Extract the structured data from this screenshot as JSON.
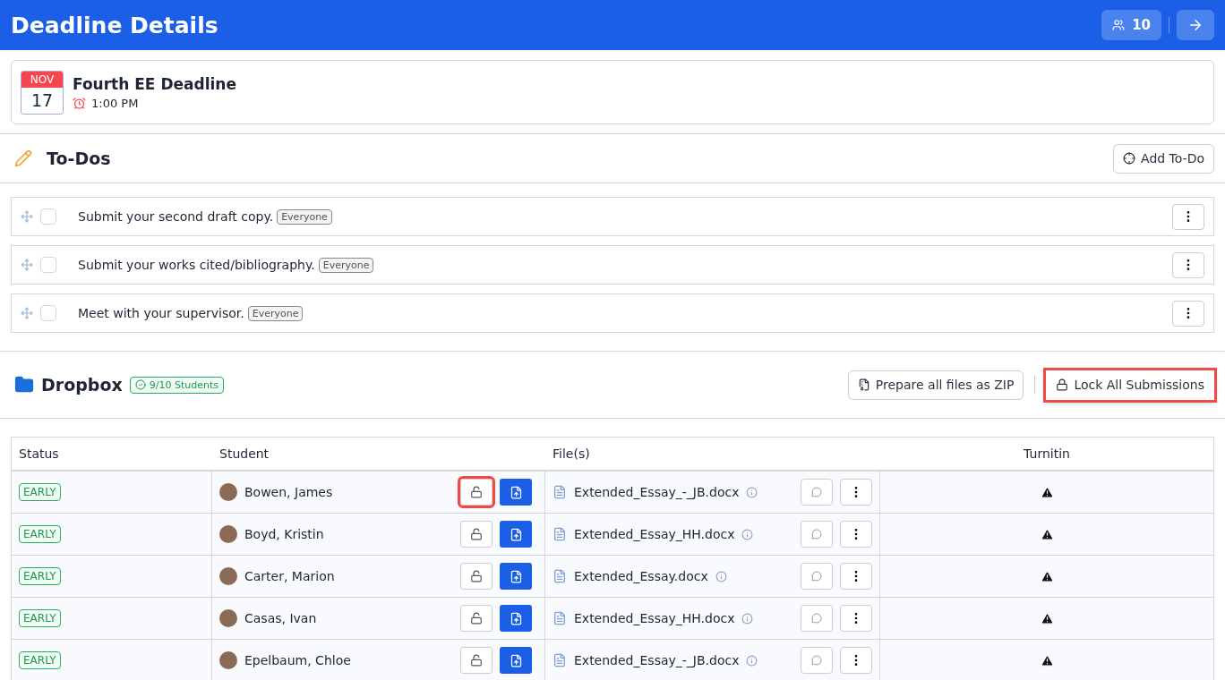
{
  "header": {
    "title": "Deadline Details",
    "members_count": "10"
  },
  "deadline": {
    "month": "NOV",
    "day": "17",
    "title": "Fourth EE Deadline",
    "time": "1:00 PM"
  },
  "todos": {
    "title": "To-Dos",
    "add_button": "Add To-Do",
    "items": [
      {
        "text": "Submit your second draft copy.",
        "audience": "Everyone",
        "checked": false
      },
      {
        "text": "Submit your works cited/bibliography.",
        "audience": "Everyone",
        "checked": false
      },
      {
        "text": "Meet with your supervisor.",
        "audience": "Everyone",
        "checked": false
      }
    ]
  },
  "dropbox": {
    "title": "Dropbox",
    "count_badge": "9/10 Students",
    "zip_button": "Prepare all files as ZIP",
    "lock_button": {
      "label": "Lock All Submissions",
      "highlighted": true
    },
    "table": {
      "columns": [
        "Status",
        "Student",
        "File(s)",
        "Turnitin"
      ],
      "rows": [
        {
          "status": "EARLY",
          "student": "Bowen, James",
          "locked": false,
          "lock_highlighted": true,
          "file": "Extended_Essay_-_JB.docx"
        },
        {
          "status": "EARLY",
          "student": "Boyd, Kristin",
          "locked": false,
          "lock_highlighted": false,
          "file": "Extended_Essay_HH.docx"
        },
        {
          "status": "EARLY",
          "student": "Carter, Marion",
          "locked": false,
          "lock_highlighted": false,
          "file": "Extended_Essay.docx"
        },
        {
          "status": "EARLY",
          "student": "Casas, Ivan",
          "locked": false,
          "lock_highlighted": false,
          "file": "Extended_Essay_HH.docx"
        },
        {
          "status": "EARLY",
          "student": "Epelbaum, Chloe",
          "locked": false,
          "lock_highlighted": false,
          "file": "Extended_Essay_-_JB.docx"
        }
      ]
    }
  }
}
